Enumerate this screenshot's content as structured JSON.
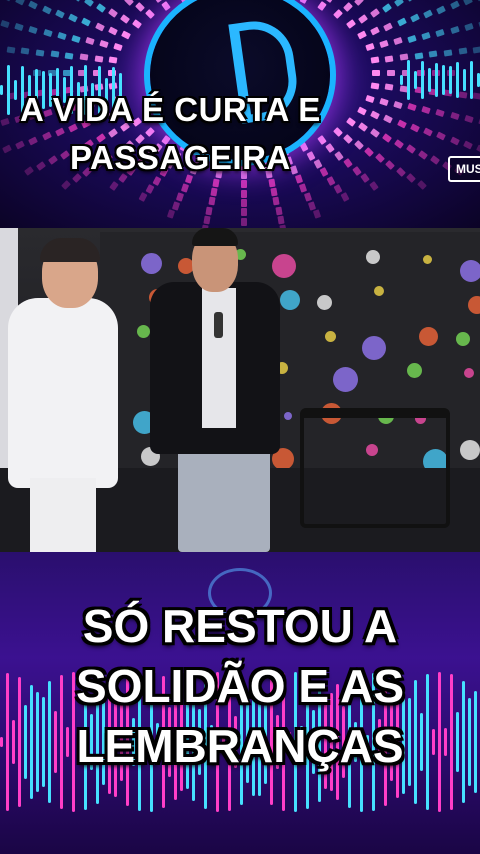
{
  "top_caption": {
    "line1": "A VIDA É CURTA E",
    "line2": "PASSAGEIRA"
  },
  "corner_tag": "MUS",
  "bottom_caption": {
    "line1": "SÓ RESTOU A",
    "line2": "SOLIDÃO E AS",
    "line3": "LEMBRANÇAS"
  },
  "colors": {
    "banner_purple": "#2a0f6e",
    "accent_blue": "#2bb8ff",
    "accent_pink": "#ff3ec8",
    "accent_cyan": "#46e0ff",
    "caption_text": "#ffffff"
  },
  "icons": {
    "logo": "music-logo-icon"
  }
}
